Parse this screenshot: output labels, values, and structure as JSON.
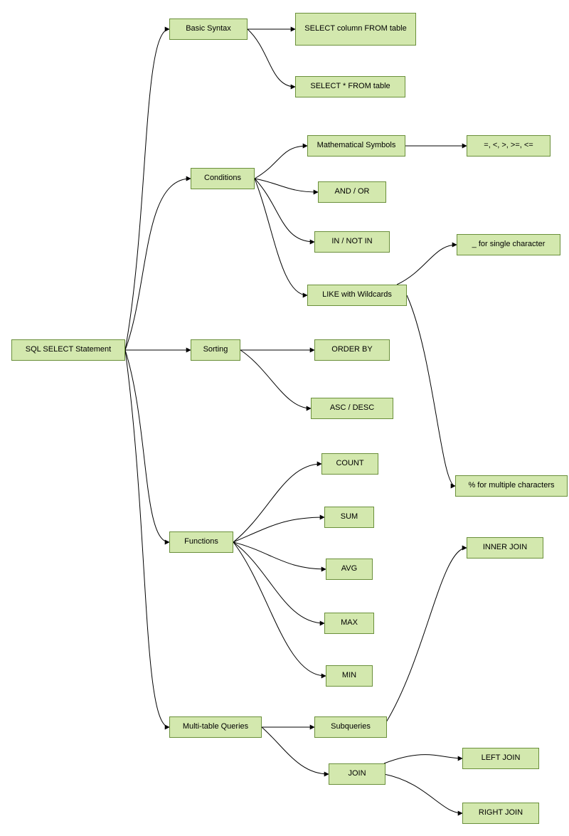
{
  "chart_data": {
    "type": "tree-diagram",
    "title": "SQL SELECT Statement",
    "root": "SQL SELECT Statement",
    "children": [
      {
        "label": "Basic Syntax",
        "children": [
          {
            "label": "SELECT column FROM table"
          },
          {
            "label": "SELECT * FROM table"
          }
        ]
      },
      {
        "label": "Conditions",
        "children": [
          {
            "label": "Mathematical Symbols",
            "children": [
              {
                "label": "=, <, >, >=, <="
              }
            ]
          },
          {
            "label": "AND / OR"
          },
          {
            "label": "IN / NOT IN"
          },
          {
            "label": "LIKE with Wildcards",
            "children": [
              {
                "label": "_ for single character"
              },
              {
                "label": "% for multiple characters"
              }
            ]
          }
        ]
      },
      {
        "label": "Sorting",
        "children": [
          {
            "label": "ORDER BY"
          },
          {
            "label": "ASC / DESC"
          }
        ]
      },
      {
        "label": "Functions",
        "children": [
          {
            "label": "COUNT"
          },
          {
            "label": "SUM"
          },
          {
            "label": "AVG"
          },
          {
            "label": "MAX"
          },
          {
            "label": "MIN"
          }
        ]
      },
      {
        "label": "Multi-table Queries",
        "children": [
          {
            "label": "Subqueries"
          },
          {
            "label": "JOIN",
            "children": [
              {
                "label": "INNER JOIN"
              },
              {
                "label": "LEFT JOIN"
              },
              {
                "label": "RIGHT JOIN"
              }
            ]
          }
        ]
      }
    ]
  },
  "nodes": {
    "root": {
      "label": "SQL SELECT Statement"
    },
    "basic": {
      "label": "Basic Syntax"
    },
    "selcol": {
      "label": "SELECT column FROM table"
    },
    "selstar": {
      "label": "SELECT * FROM table"
    },
    "cond": {
      "label": "Conditions"
    },
    "mathsym": {
      "label": "Mathematical Symbols"
    },
    "ops": {
      "label": "=, <, >, >=, <="
    },
    "andor": {
      "label": "AND / OR"
    },
    "innotin": {
      "label": "IN / NOT IN"
    },
    "like": {
      "label": "LIKE with Wildcards"
    },
    "underscore": {
      "label": "_ for single character"
    },
    "percent": {
      "label": "% for multiple characters"
    },
    "sort": {
      "label": "Sorting"
    },
    "orderby": {
      "label": "ORDER BY"
    },
    "ascdesc": {
      "label": "ASC / DESC"
    },
    "func": {
      "label": "Functions"
    },
    "count": {
      "label": "COUNT"
    },
    "sum": {
      "label": "SUM"
    },
    "avg": {
      "label": "AVG"
    },
    "max": {
      "label": "MAX"
    },
    "min": {
      "label": "MIN"
    },
    "multi": {
      "label": "Multi-table Queries"
    },
    "subq": {
      "label": "Subqueries"
    },
    "join": {
      "label": "JOIN"
    },
    "inner": {
      "label": "INNER JOIN"
    },
    "left": {
      "label": "LEFT JOIN"
    },
    "right": {
      "label": "RIGHT JOIN"
    }
  }
}
